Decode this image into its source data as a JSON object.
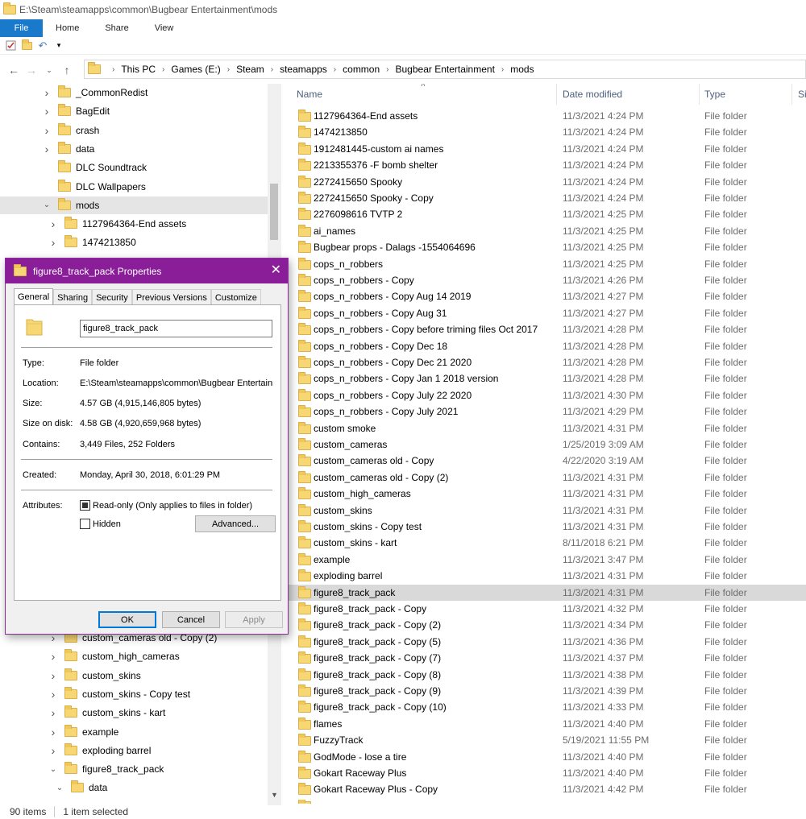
{
  "window": {
    "title": "E:\\Steam\\steamapps\\common\\Bugbear Entertainment\\mods"
  },
  "ribbon": {
    "tabs": [
      "File",
      "Home",
      "Share",
      "View"
    ]
  },
  "nav": {
    "breadcrumb": [
      "This PC",
      "Games (E:)",
      "Steam",
      "steamapps",
      "common",
      "Bugbear Entertainment",
      "mods"
    ]
  },
  "tree_top": [
    {
      "label": "_CommonRedist",
      "level": 1,
      "expandable": true
    },
    {
      "label": "BagEdit",
      "level": 1,
      "expandable": true
    },
    {
      "label": "crash",
      "level": 1,
      "expandable": true
    },
    {
      "label": "data",
      "level": 1,
      "expandable": true
    },
    {
      "label": "DLC Soundtrack",
      "level": 1,
      "expandable": false
    },
    {
      "label": "DLC Wallpapers",
      "level": 1,
      "expandable": false
    },
    {
      "label": "mods",
      "level": 1,
      "expanded": true,
      "selected": true
    },
    {
      "label": "1127964364-End assets",
      "level": 2,
      "expandable": true
    },
    {
      "label": "1474213850",
      "level": 2,
      "expandable": true
    }
  ],
  "tree_bottom": [
    {
      "label": "custom_cameras old - Copy (2)",
      "level": 2,
      "expandable": true
    },
    {
      "label": "custom_high_cameras",
      "level": 2,
      "expandable": true
    },
    {
      "label": "custom_skins",
      "level": 2,
      "expandable": true
    },
    {
      "label": "custom_skins - Copy test",
      "level": 2,
      "expandable": true
    },
    {
      "label": "custom_skins - kart",
      "level": 2,
      "expandable": true
    },
    {
      "label": "example",
      "level": 2,
      "expandable": true
    },
    {
      "label": "exploding barrel",
      "level": 2,
      "expandable": true
    },
    {
      "label": "figure8_track_pack",
      "level": 2,
      "expanded": true
    },
    {
      "label": "data",
      "level": 3,
      "expanded": true
    }
  ],
  "list": {
    "columns": {
      "name": "Name",
      "date": "Date modified",
      "type": "Type",
      "size": "Si"
    },
    "rows": [
      {
        "name": "1127964364-End assets",
        "date": "11/3/2021 4:24 PM",
        "type": "File folder"
      },
      {
        "name": "1474213850",
        "date": "11/3/2021 4:24 PM",
        "type": "File folder"
      },
      {
        "name": "1912481445-custom ai names",
        "date": "11/3/2021 4:24 PM",
        "type": "File folder"
      },
      {
        "name": "2213355376 -F bomb shelter",
        "date": "11/3/2021 4:24 PM",
        "type": "File folder"
      },
      {
        "name": "2272415650 Spooky",
        "date": "11/3/2021 4:24 PM",
        "type": "File folder"
      },
      {
        "name": "2272415650 Spooky - Copy",
        "date": "11/3/2021 4:24 PM",
        "type": "File folder"
      },
      {
        "name": "2276098616 TVTP 2",
        "date": "11/3/2021 4:25 PM",
        "type": "File folder"
      },
      {
        "name": "ai_names",
        "date": "11/3/2021 4:25 PM",
        "type": "File folder"
      },
      {
        "name": "Bugbear props - Dalags -1554064696",
        "date": "11/3/2021 4:25 PM",
        "type": "File folder"
      },
      {
        "name": "cops_n_robbers",
        "date": "11/3/2021 4:25 PM",
        "type": "File folder"
      },
      {
        "name": "cops_n_robbers - Copy",
        "date": "11/3/2021 4:26 PM",
        "type": "File folder"
      },
      {
        "name": "cops_n_robbers - Copy Aug 14 2019",
        "date": "11/3/2021 4:27 PM",
        "type": "File folder"
      },
      {
        "name": "cops_n_robbers - Copy Aug 31",
        "date": "11/3/2021 4:27 PM",
        "type": "File folder"
      },
      {
        "name": "cops_n_robbers - Copy before triming files Oct 2017",
        "date": "11/3/2021 4:28 PM",
        "type": "File folder"
      },
      {
        "name": "cops_n_robbers - Copy Dec 18",
        "date": "11/3/2021 4:28 PM",
        "type": "File folder"
      },
      {
        "name": "cops_n_robbers - Copy Dec 21 2020",
        "date": "11/3/2021 4:28 PM",
        "type": "File folder"
      },
      {
        "name": "cops_n_robbers - Copy Jan 1 2018 version",
        "date": "11/3/2021 4:28 PM",
        "type": "File folder"
      },
      {
        "name": "cops_n_robbers - Copy July 22  2020",
        "date": "11/3/2021 4:30 PM",
        "type": "File folder"
      },
      {
        "name": "cops_n_robbers - Copy July 2021",
        "date": "11/3/2021 4:29 PM",
        "type": "File folder"
      },
      {
        "name": "custom smoke",
        "date": "11/3/2021 4:31 PM",
        "type": "File folder"
      },
      {
        "name": "custom_cameras",
        "date": "1/25/2019 3:09 AM",
        "type": "File folder"
      },
      {
        "name": "custom_cameras old - Copy",
        "date": "4/22/2020 3:19 AM",
        "type": "File folder"
      },
      {
        "name": "custom_cameras old - Copy (2)",
        "date": "11/3/2021 4:31 PM",
        "type": "File folder"
      },
      {
        "name": "custom_high_cameras",
        "date": "11/3/2021 4:31 PM",
        "type": "File folder"
      },
      {
        "name": "custom_skins",
        "date": "11/3/2021 4:31 PM",
        "type": "File folder"
      },
      {
        "name": "custom_skins - Copy test",
        "date": "11/3/2021 4:31 PM",
        "type": "File folder"
      },
      {
        "name": "custom_skins - kart",
        "date": "8/11/2018 6:21 PM",
        "type": "File folder"
      },
      {
        "name": "example",
        "date": "11/3/2021 3:47 PM",
        "type": "File folder"
      },
      {
        "name": "exploding barrel",
        "date": "11/3/2021 4:31 PM",
        "type": "File folder"
      },
      {
        "name": "figure8_track_pack",
        "date": "11/3/2021 4:31 PM",
        "type": "File folder",
        "selected": true
      },
      {
        "name": "figure8_track_pack - Copy",
        "date": "11/3/2021 4:32 PM",
        "type": "File folder"
      },
      {
        "name": "figure8_track_pack - Copy (2)",
        "date": "11/3/2021 4:34 PM",
        "type": "File folder"
      },
      {
        "name": "figure8_track_pack - Copy (5)",
        "date": "11/3/2021 4:36 PM",
        "type": "File folder"
      },
      {
        "name": "figure8_track_pack - Copy (7)",
        "date": "11/3/2021 4:37 PM",
        "type": "File folder"
      },
      {
        "name": "figure8_track_pack - Copy (8)",
        "date": "11/3/2021 4:38 PM",
        "type": "File folder"
      },
      {
        "name": "figure8_track_pack - Copy (9)",
        "date": "11/3/2021 4:39 PM",
        "type": "File folder"
      },
      {
        "name": "figure8_track_pack - Copy (10)",
        "date": "11/3/2021 4:33 PM",
        "type": "File folder"
      },
      {
        "name": "flames",
        "date": "11/3/2021 4:40 PM",
        "type": "File folder"
      },
      {
        "name": "FuzzyTrack",
        "date": "5/19/2021 11:55 PM",
        "type": "File folder"
      },
      {
        "name": "GodMode - lose a tire",
        "date": "11/3/2021 4:40 PM",
        "type": "File folder"
      },
      {
        "name": "Gokart Raceway Plus",
        "date": "11/3/2021 4:40 PM",
        "type": "File folder"
      },
      {
        "name": "Gokart Raceway Plus - Copy",
        "date": "11/3/2021 4:42 PM",
        "type": "File folder"
      }
    ]
  },
  "status": {
    "items": "90 items",
    "selected": "1 item selected"
  },
  "dialog": {
    "title": "figure8_track_pack Properties",
    "tabs": [
      "General",
      "Sharing",
      "Security",
      "Previous Versions",
      "Customize"
    ],
    "name": "figure8_track_pack",
    "type_label": "Type:",
    "type_value": "File folder",
    "location_label": "Location:",
    "location_value": "E:\\Steam\\steamapps\\common\\Bugbear Entertainme",
    "size_label": "Size:",
    "size_value": "4.57 GB (4,915,146,805 bytes)",
    "disk_label": "Size on disk:",
    "disk_value": "4.58 GB (4,920,659,968 bytes)",
    "contains_label": "Contains:",
    "contains_value": "3,449 Files, 252 Folders",
    "created_label": "Created:",
    "created_value": "Monday, April 30, 2018, 6:01:29 PM",
    "attributes_label": "Attributes:",
    "readonly_label": "Read-only (Only applies to files in folder)",
    "hidden_label": "Hidden",
    "advanced_label": "Advanced...",
    "ok_label": "OK",
    "cancel_label": "Cancel",
    "apply_label": "Apply"
  }
}
